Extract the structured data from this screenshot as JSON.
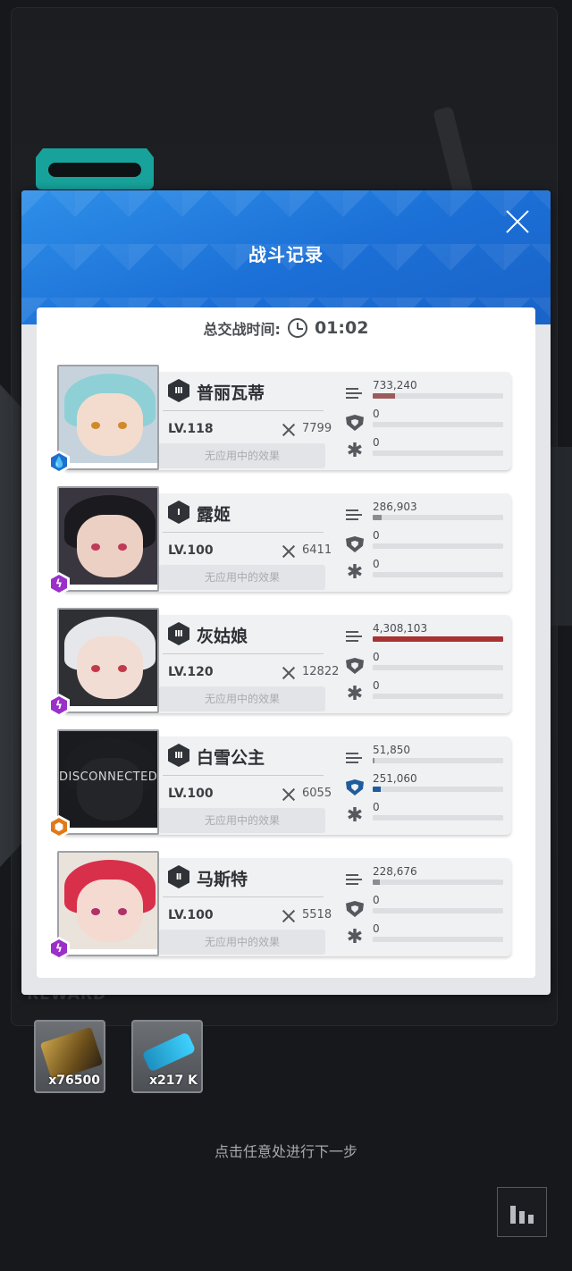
{
  "modal": {
    "title": "战斗记录",
    "time_label": "总交战时间:",
    "time_value": "01:02"
  },
  "effect_text": "无应用中的效果",
  "characters": [
    {
      "name": "普丽瓦蒂",
      "rank": "Ⅲ",
      "level": "LV.118",
      "power": "7799",
      "element": "water",
      "element_color": "#1f6fd0",
      "portrait": {
        "hair": "#8fd0d6",
        "skin": "#f3dccd",
        "eye": "#d08a2a",
        "bg": "#c7d3dc"
      },
      "disconnected": "",
      "stats": {
        "damage": {
          "label": "733,240",
          "fraction": 0.17,
          "color": "#9c5b5b"
        },
        "shield": {
          "label": "0",
          "fraction": 0,
          "color": "#1f5c9e"
        },
        "heal": {
          "label": "0",
          "fraction": 0,
          "color": "#888888"
        }
      }
    },
    {
      "name": "露姬",
      "rank": "Ⅰ",
      "level": "LV.100",
      "power": "6411",
      "element": "electric",
      "element_color": "#9a2fc9",
      "portrait": {
        "hair": "#1b1a1f",
        "skin": "#ecd0c4",
        "eye": "#c03a5a",
        "bg": "#3a3640"
      },
      "disconnected": "",
      "stats": {
        "damage": {
          "label": "286,903",
          "fraction": 0.07,
          "color": "#8a8d92"
        },
        "shield": {
          "label": "0",
          "fraction": 0,
          "color": "#1f5c9e"
        },
        "heal": {
          "label": "0",
          "fraction": 0,
          "color": "#888888"
        }
      }
    },
    {
      "name": "灰姑娘",
      "rank": "Ⅲ",
      "level": "LV.120",
      "power": "12822",
      "element": "electric",
      "element_color": "#9a2fc9",
      "portrait": {
        "hair": "#e6e7ea",
        "skin": "#f1ddd4",
        "eye": "#c23a4a",
        "bg": "#2f3034"
      },
      "disconnected": "",
      "stats": {
        "damage": {
          "label": "4,308,103",
          "fraction": 1.0,
          "color": "#a83232"
        },
        "shield": {
          "label": "0",
          "fraction": 0,
          "color": "#1f5c9e"
        },
        "heal": {
          "label": "0",
          "fraction": 0,
          "color": "#888888"
        }
      }
    },
    {
      "name": "白雪公主",
      "rank": "Ⅲ",
      "level": "LV.100",
      "power": "6055",
      "element": "iron",
      "element_color": "#e07a18",
      "portrait": {
        "hair": "#1c1d20",
        "skin": "#242528",
        "eye": "#242528",
        "bg": "#1a1b1e"
      },
      "disconnected": "DISCONNECTED",
      "stats": {
        "damage": {
          "label": "51,850",
          "fraction": 0.012,
          "color": "#8a8d92"
        },
        "shield": {
          "label": "251,060",
          "fraction": 0.06,
          "color": "#1f5c9e"
        },
        "heal": {
          "label": "0",
          "fraction": 0,
          "color": "#888888"
        }
      }
    },
    {
      "name": "马斯特",
      "rank": "Ⅱ",
      "level": "LV.100",
      "power": "5518",
      "element": "electric",
      "element_color": "#9a2fc9",
      "portrait": {
        "hair": "#d8304a",
        "skin": "#f4dad0",
        "eye": "#b0306a",
        "bg": "#e9e3dc"
      },
      "disconnected": "",
      "stats": {
        "damage": {
          "label": "228,676",
          "fraction": 0.053,
          "color": "#8a8d92"
        },
        "shield": {
          "label": "0",
          "fraction": 0,
          "color": "#1f5c9e"
        },
        "heal": {
          "label": "0",
          "fraction": 0,
          "color": "#888888"
        }
      }
    }
  ],
  "rewards": {
    "label": "REWARD",
    "items": [
      {
        "name": "credit-card",
        "qty": "x76500"
      },
      {
        "name": "data-usb",
        "qty": "x217 K"
      }
    ]
  },
  "hint": "点击任意处进行下一步"
}
